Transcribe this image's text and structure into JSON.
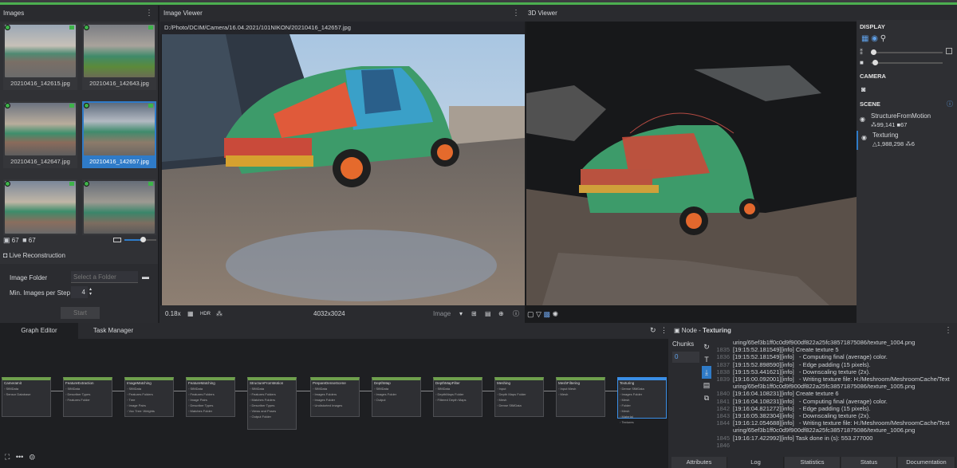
{
  "panels": {
    "images": "Images",
    "viewer": "Image Viewer",
    "viewer3d": "3D Viewer"
  },
  "images": [
    {
      "name": "20210416_142615.jpg"
    },
    {
      "name": "20210416_142643.jpg"
    },
    {
      "name": "20210416_142647.jpg"
    },
    {
      "name": "20210416_142657.jpg"
    },
    {
      "name": ""
    },
    {
      "name": ""
    }
  ],
  "image_counts": {
    "a": "67",
    "b": "67"
  },
  "live": {
    "title": "Live Reconstruction",
    "folder_label": "Image Folder",
    "folder_placeholder": "Select a Folder",
    "min_label": "Min. Images per Step",
    "min_value": "4",
    "start": "Start"
  },
  "viewer": {
    "path": "D:/Photo/DCIM/Camera/16.04.2021/101NIKON/20210416_142657.jpg",
    "zoom": "0.18x",
    "hdr": "HDR",
    "resolution": "4032x3024",
    "mode": "Image"
  },
  "display": {
    "title": "DISPLAY",
    "camera": "CAMERA",
    "scene": "SCENE",
    "scene_items": [
      {
        "name": "StructureFromMotion",
        "stat1": "99,141",
        "stat2": "67"
      },
      {
        "name": "Texturing",
        "stat1": "1,988,298",
        "stat2": "6"
      }
    ]
  },
  "graph": {
    "tab1": "Graph Editor",
    "tab2": "Task Manager",
    "nodes": [
      {
        "title": "CameraInit",
        "ports": [
          "SfMData",
          "Sensor Database"
        ]
      },
      {
        "title": "FeatureExtraction",
        "ports": [
          "SfMData",
          "Describer Types",
          "Features Folder"
        ]
      },
      {
        "title": "ImageMatching",
        "ports": [
          "SfMData",
          "Features Folders",
          "Tree",
          "Image Pairs",
          "Voc Tree: Weights"
        ]
      },
      {
        "title": "FeatureMatching",
        "ports": [
          "SfMData",
          "Features Folders",
          "Image Pairs",
          "Describer Types",
          "Matches Folder"
        ]
      },
      {
        "title": "StructureFromMotion",
        "ports": [
          "SfMData",
          "Features Folders",
          "Matches Folders",
          "Describer Types",
          "Views and Poses",
          "Output Folder"
        ]
      },
      {
        "title": "PrepareDenseScene",
        "ports": [
          "SfMData",
          "Images Folders",
          "Images Folder",
          "Undistorted Images"
        ]
      },
      {
        "title": "DepthMap",
        "ports": [
          "SfMData",
          "Images Folder",
          "Output"
        ]
      },
      {
        "title": "DepthMapFilter",
        "ports": [
          "SfMData",
          "DepthMaps Folder",
          "Filtered Depth Maps"
        ]
      },
      {
        "title": "Meshing",
        "ports": [
          "Input",
          "Depth Maps Folder",
          "Mesh",
          "Dense SfMData"
        ]
      },
      {
        "title": "MeshFiltering",
        "ports": [
          "Input Mesh",
          "Mesh"
        ]
      },
      {
        "title": "Texturing",
        "ports": [
          "Dense SfMData",
          "Images Folder",
          "Mesh",
          "Folder",
          "Mesh",
          "Material",
          "Textures"
        ]
      }
    ]
  },
  "node": {
    "label": "Node",
    "name": "Texturing",
    "chunks": "Chunks",
    "chunk0": "0",
    "log": [
      {
        "n": "",
        "t": "uring/65ef3b1ff0c0d9f900df822a25fc38571875086/texture_1004.png"
      },
      {
        "n": "1835",
        "t": "[19:15:52.181549][info] Create texture 5"
      },
      {
        "n": "1836",
        "t": "[19:15:52.181549][info]   - Computing final (average) color."
      },
      {
        "n": "1837",
        "t": "[19:15:52.898590][info]   - Edge padding (15 pixels)."
      },
      {
        "n": "1838",
        "t": "[19:15:53.441621][info]   - Downscaling texture (2x)."
      },
      {
        "n": "1839",
        "t": "[19:16:00.092001][info]   - Writing texture file: H:/Meshroom/MeshroomCache/Text"
      },
      {
        "n": "",
        "t": "uring/65ef3b1ff0c0d9f900df822a25fc38571875086/texture_1005.png"
      },
      {
        "n": "1840",
        "t": "[19:16:04.108231][info] Create texture 6"
      },
      {
        "n": "1841",
        "t": "[19:16:04.108231][info]   - Computing final (average) color."
      },
      {
        "n": "1842",
        "t": "[19:16:04.821272][info]   - Edge padding (15 pixels)."
      },
      {
        "n": "1843",
        "t": "[19:16:05.382304][info]   - Downscaling texture (2x)."
      },
      {
        "n": "1844",
        "t": "[19:16:12.054688][info]   - Writing texture file: H:/Meshroom/MeshroomCache/Text"
      },
      {
        "n": "",
        "t": "uring/65ef3b1ff0c0d9f900df822a25fc38571875086/texture_1006.png"
      },
      {
        "n": "1845",
        "t": "[19:16:17.422992][info] Task done in (s): 553.277000"
      },
      {
        "n": "1846",
        "t": ""
      }
    ],
    "tabs": [
      "Attributes",
      "Log",
      "Statistics",
      "Status",
      "Documentation"
    ]
  },
  "colors": {
    "accent": "#4caf50",
    "selection": "#2f7bc8",
    "node_header": "#6fa04d",
    "selected_node": "#3a8ee6"
  }
}
